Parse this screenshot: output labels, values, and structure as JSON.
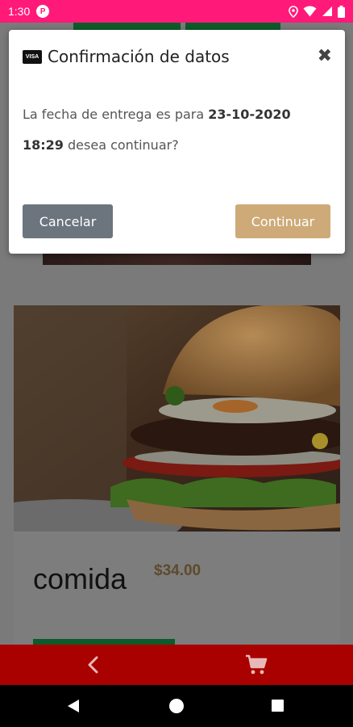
{
  "status_bar": {
    "time": "1:30",
    "app_icon_letter": "P",
    "background_color": "#ff1a7a",
    "icons": [
      "location-icon",
      "wifi-icon",
      "signal-icon",
      "battery-icon"
    ]
  },
  "modal": {
    "card_icon_text": "VISA",
    "title": "Confirmación de datos",
    "close_symbol": "✖",
    "message_prefix": "La fecha de entrega es para ",
    "message_date": "23-10-2020 18:29",
    "message_suffix": " desea continuar?",
    "cancel_label": "Cancelar",
    "continue_label": "Continuar",
    "cancel_color": "#6c757d",
    "continue_color": "#cdaa78"
  },
  "product": {
    "name": "comida",
    "price": "$34.00"
  },
  "app_bar": {
    "background_color": "#a90000",
    "icons": [
      "chevron-left-icon",
      "cart-icon"
    ]
  },
  "nav_bar": {
    "icons": [
      "nav-back-icon",
      "nav-home-icon",
      "nav-recents-icon"
    ]
  }
}
